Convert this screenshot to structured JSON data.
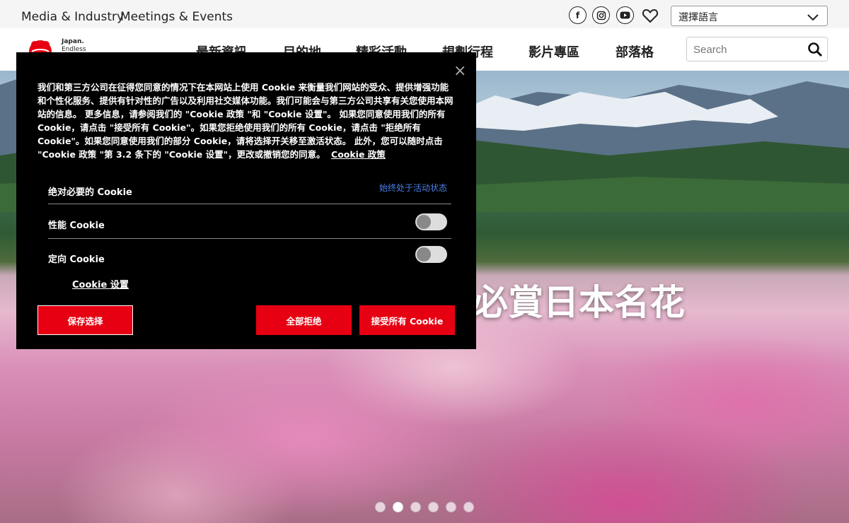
{
  "topbar": {
    "media_industry": "Media & Industry",
    "meetings_events": "Meetings & Events",
    "social_icons": [
      "facebook-icon",
      "instagram-icon",
      "youtube-icon"
    ],
    "language_select": {
      "selected": "選擇語言"
    }
  },
  "logo": {
    "line1": "Japan.",
    "line2": "Endless",
    "brand_color": "#e60012"
  },
  "nav": {
    "items": [
      {
        "label": "最新資訊"
      },
      {
        "label": "目的地"
      },
      {
        "label": "精彩活動"
      },
      {
        "label": "規劃行程"
      },
      {
        "label": "影片專區"
      },
      {
        "label": "部落格"
      }
    ],
    "search_placeholder": "Search"
  },
  "hero": {
    "headline": "必賞日本名花",
    "slides_total": 6,
    "active_slide": 2
  },
  "cookie_banner": {
    "close_symbol": "×",
    "body_text": "我们和第三方公司在征得您同意的情况下在本网站上使用 Cookie 来衡量我们网站的受众、提供增强功能和个性化服务、提供有针对性的广告以及利用社交媒体功能。我们可能会与第三方公司共享有关您使用本网站的信息。 更多信息，请参阅我们的 \"Cookie 政策 \"和 \"Cookie 设置\"。 如果您同意使用我们的所有 Cookie，请点击 \"接受所有 Cookie\"。如果您拒绝使用我们的所有 Cookie，请点击 \"拒绝所有 Cookie\"。如果您同意使用我们的部分 Cookie，请将选择开关移至激活状态。 此外，您可以随时点击 \"Cookie 政策 \"第 3.2 条下的 \"Cookie 设置\"，更改或撤销您的同意。",
    "policy_link": "Cookie 政策",
    "rows": [
      {
        "label": "绝对必要的 Cookie",
        "status": "始终处于活动状态"
      },
      {
        "label": "性能 Cookie",
        "enabled": false
      },
      {
        "label": "定向 Cookie",
        "enabled": false
      }
    ],
    "settings_link": "Cookie 设置",
    "buttons": {
      "save": "保存选择",
      "reject_all": "全部拒绝",
      "accept_all": "接受所有 Cookie"
    },
    "status_color": "#4a7fe8",
    "button_color": "#e60012"
  }
}
